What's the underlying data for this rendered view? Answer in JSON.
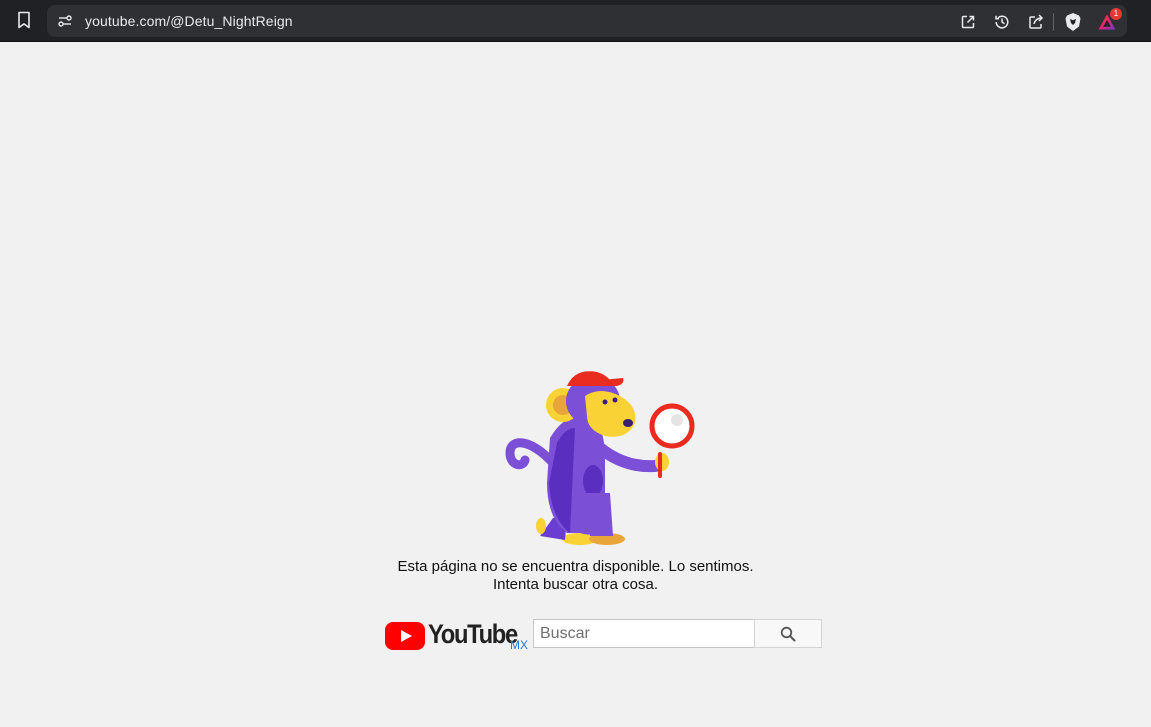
{
  "browser": {
    "url": "youtube.com/@Detu_NightReign",
    "rewards_badge_count": "1",
    "icons": [
      "bookmark-icon",
      "site-info-icon",
      "open-external-icon",
      "history-icon",
      "share-icon",
      "brave-shields-icon",
      "brave-rewards-icon"
    ],
    "colors": {
      "toolbar": "#202124",
      "omnibox": "#2f3033",
      "badge": "#e53935"
    }
  },
  "error_page": {
    "line1": "Esta página no se encuentra disponible. Lo sentimos.",
    "line2": "Intenta buscar otra cosa.",
    "illustration": "monkey-with-magnifying-glass"
  },
  "youtube": {
    "wordmark": "YouTube",
    "region": "MX",
    "search_placeholder": "Buscar",
    "colors": {
      "brand_red": "#ff0000",
      "region_blue": "#2a77c9",
      "background": "#f1f1f1"
    }
  }
}
